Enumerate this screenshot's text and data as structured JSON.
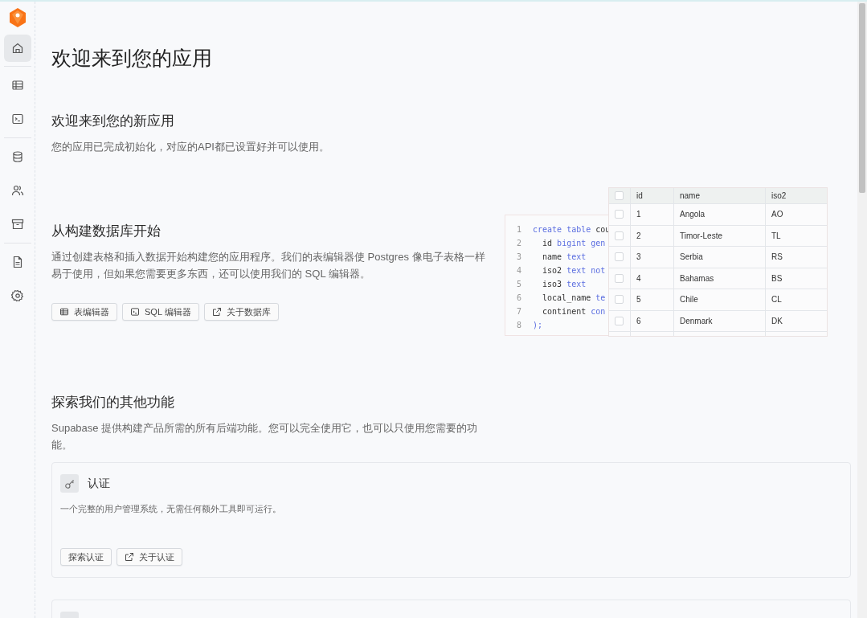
{
  "sidebar": {
    "groups": [
      [
        {
          "selected": true
        }
      ],
      [
        {
          "selected": false
        },
        {
          "selected": false
        }
      ],
      [
        {
          "selected": false
        },
        {
          "selected": false
        },
        {
          "selected": false
        }
      ],
      [
        {
          "selected": false
        },
        {
          "selected": false
        }
      ]
    ]
  },
  "page_title": "欢迎来到您的应用",
  "welcome": {
    "title": "欢迎来到您的新应用",
    "text": "您的应用已完成初始化，对应的API都已设置好并可以使用。"
  },
  "database": {
    "title": "从构建数据库开始",
    "text": "通过创建表格和插入数据开始构建您的应用程序。我们的表编辑器使 Postgres 像电子表格一样易于使用，但如果您需要更多东西，还可以使用我们的 SQL 编辑器。",
    "buttons": [
      "表编辑器",
      "SQL 编辑器",
      "关于数据库"
    ],
    "code": [
      {
        "num": "1",
        "tokens": [
          {
            "text": "create table ",
            "kind": "kw"
          },
          {
            "text": "cou",
            "kind": "plain"
          }
        ]
      },
      {
        "num": "2",
        "tokens": [
          {
            "text": "  id ",
            "kind": "plain"
          },
          {
            "text": "bigint gen",
            "kind": "kw"
          }
        ]
      },
      {
        "num": "3",
        "tokens": [
          {
            "text": "  name ",
            "kind": "plain"
          },
          {
            "text": "text",
            "kind": "kw"
          }
        ]
      },
      {
        "num": "4",
        "tokens": [
          {
            "text": "  iso2 ",
            "kind": "plain"
          },
          {
            "text": "text not",
            "kind": "kw"
          }
        ]
      },
      {
        "num": "5",
        "tokens": [
          {
            "text": "  iso3 ",
            "kind": "plain"
          },
          {
            "text": "text",
            "kind": "kw"
          }
        ]
      },
      {
        "num": "6",
        "tokens": [
          {
            "text": "  local_name ",
            "kind": "plain"
          },
          {
            "text": "te",
            "kind": "kw"
          }
        ]
      },
      {
        "num": "7",
        "tokens": [
          {
            "text": "  continent ",
            "kind": "plain"
          },
          {
            "text": "con",
            "kind": "kw"
          }
        ]
      },
      {
        "num": "8",
        "tokens": [
          {
            "text": ");",
            "kind": "kw"
          }
        ]
      }
    ],
    "table": {
      "header_checked": false,
      "columns": [
        "id",
        "name",
        "iso2"
      ],
      "rows": [
        {
          "checked": false,
          "cells": [
            "1",
            "Angola",
            "AO"
          ]
        },
        {
          "checked": false,
          "cells": [
            "2",
            "Timor-Leste",
            "TL"
          ]
        },
        {
          "checked": false,
          "cells": [
            "3",
            "Serbia",
            "RS"
          ]
        },
        {
          "checked": false,
          "cells": [
            "4",
            "Bahamas",
            "BS"
          ]
        },
        {
          "checked": false,
          "cells": [
            "5",
            "Chile",
            "CL"
          ]
        },
        {
          "checked": false,
          "cells": [
            "6",
            "Denmark",
            "DK"
          ]
        }
      ]
    }
  },
  "features": {
    "title": "探索我们的其他功能",
    "text": "Supabase 提供构建产品所需的所有后端功能。您可以完全使用它，也可以只使用您需要的功能。",
    "cards": [
      {
        "title": "认证",
        "text": "一个完整的用户管理系统，无需任何额外工具即可运行。",
        "buttons": [
          {
            "label": "探索认证",
            "kind": "plain"
          },
          {
            "label": "关于认证",
            "kind": "external"
          }
        ]
      }
    ]
  }
}
